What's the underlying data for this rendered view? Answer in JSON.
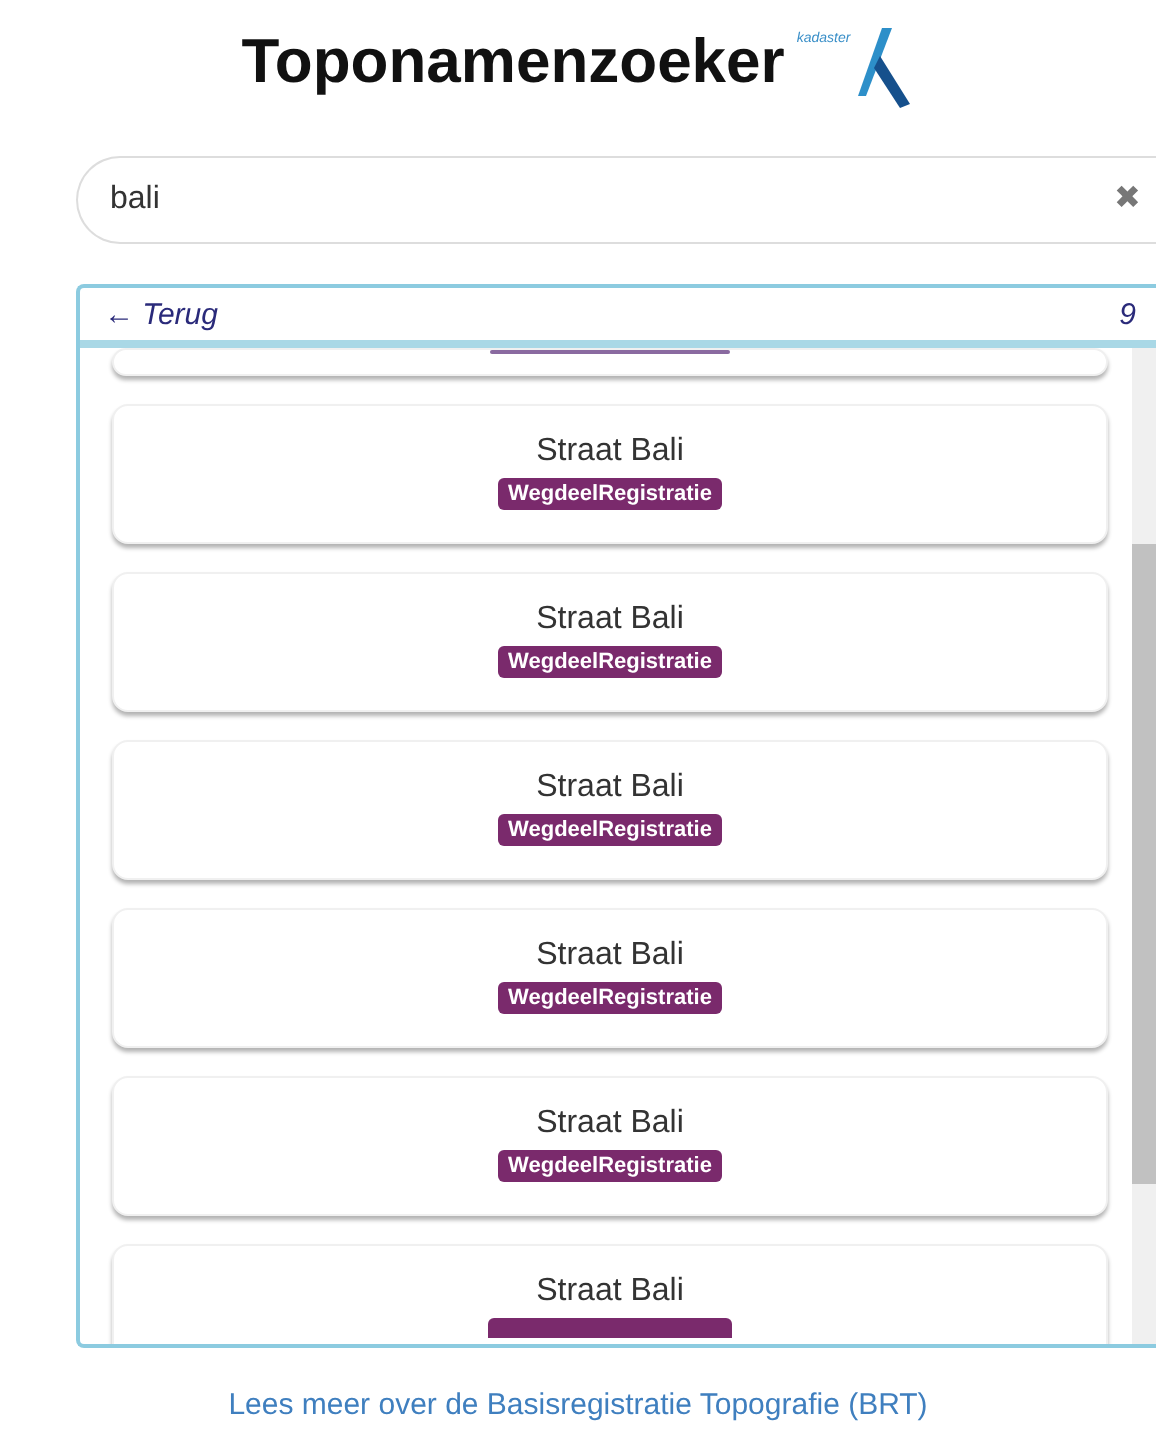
{
  "header": {
    "title": "Toponamenzoeker",
    "logo_text": "kadaster"
  },
  "search": {
    "value": "bali",
    "clear_icon": "✖"
  },
  "results": {
    "back": "← Terug",
    "count": "9",
    "items": [
      {
        "kind": "partial"
      },
      {
        "kind": "full",
        "title": "Straat Bali",
        "badge": "WegdeelRegistratie"
      },
      {
        "kind": "full",
        "title": "Straat Bali",
        "badge": "WegdeelRegistratie"
      },
      {
        "kind": "full",
        "title": "Straat Bali",
        "badge": "WegdeelRegistratie"
      },
      {
        "kind": "full",
        "title": "Straat Bali",
        "badge": "WegdeelRegistratie"
      },
      {
        "kind": "full",
        "title": "Straat Bali",
        "badge": "WegdeelRegistratie"
      },
      {
        "kind": "cut",
        "title": "Straat Bali"
      }
    ]
  },
  "footer_link": "Lees meer over de Basisregistratie Topografie (BRT)"
}
